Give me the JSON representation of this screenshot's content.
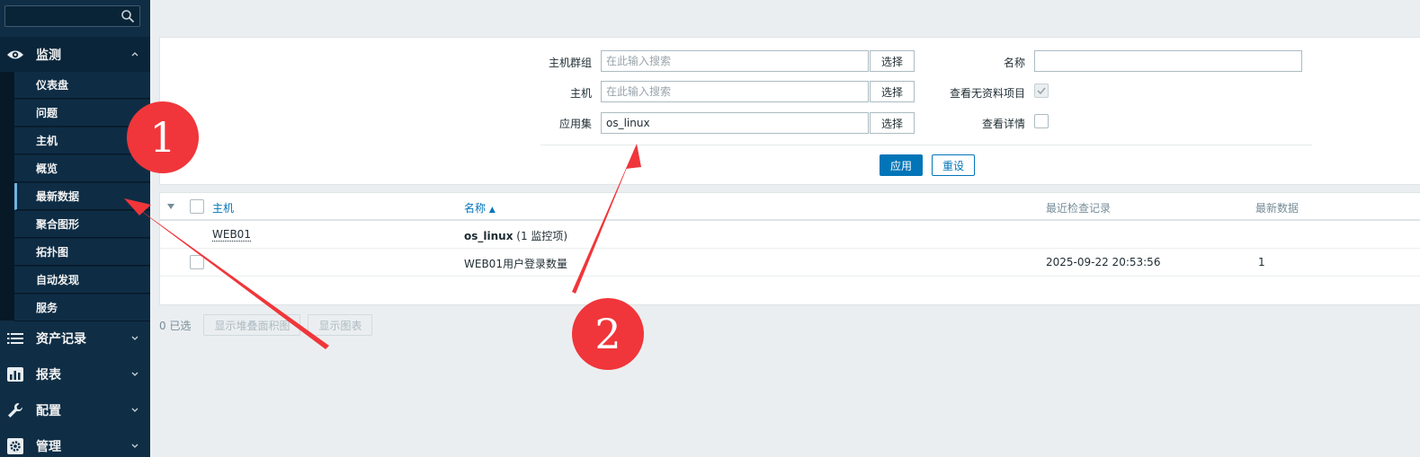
{
  "sidebar": {
    "search": {
      "value": "",
      "placeholder": ""
    },
    "monitoring": {
      "label": "监测",
      "expanded": true
    },
    "submenu": [
      {
        "label": "仪表盘"
      },
      {
        "label": "问题"
      },
      {
        "label": "主机"
      },
      {
        "label": "概览"
      },
      {
        "label": "最新数据",
        "selected": true
      },
      {
        "label": "聚合图形"
      },
      {
        "label": "拓扑图"
      },
      {
        "label": "自动发现"
      },
      {
        "label": "服务"
      }
    ],
    "inventory": {
      "label": "资产记录"
    },
    "reports": {
      "label": "报表"
    },
    "configuration": {
      "label": "配置"
    },
    "administration": {
      "label": "管理"
    }
  },
  "filter": {
    "host_group": {
      "label": "主机群组",
      "placeholder": "在此输入搜索",
      "value": ""
    },
    "host": {
      "label": "主机",
      "placeholder": "在此输入搜索",
      "value": ""
    },
    "application": {
      "label": "应用集",
      "value": "os_linux"
    },
    "select_label": "选择",
    "name": {
      "label": "名称",
      "value": ""
    },
    "show_without_data": {
      "label": "查看无资料项目",
      "checked": true
    },
    "show_details": {
      "label": "查看详情",
      "checked": false
    },
    "apply_label": "应用",
    "reset_label": "重设"
  },
  "table": {
    "headers": {
      "host": "主机",
      "name": "名称",
      "sort_arrow": "▲",
      "last_check": "最近检查记录",
      "last_value": "最新数据"
    },
    "group_row": {
      "host": "WEB01",
      "app_name": "os_linux",
      "app_count": "(1 监控项)"
    },
    "item_row": {
      "name": "WEB01用户登录数量",
      "last_check": "2025-09-22 20:53:56",
      "last_value": "1"
    }
  },
  "footer": {
    "selected_count": "0 已选",
    "stacked_graph_label": "显示堆叠面积图",
    "graph_label": "显示图表"
  },
  "annotations": {
    "badge1": "1",
    "badge2": "2"
  },
  "colors": {
    "sidebar_bg": "#0f2e45",
    "accent": "#0275b8",
    "badge": "#f0363a"
  }
}
